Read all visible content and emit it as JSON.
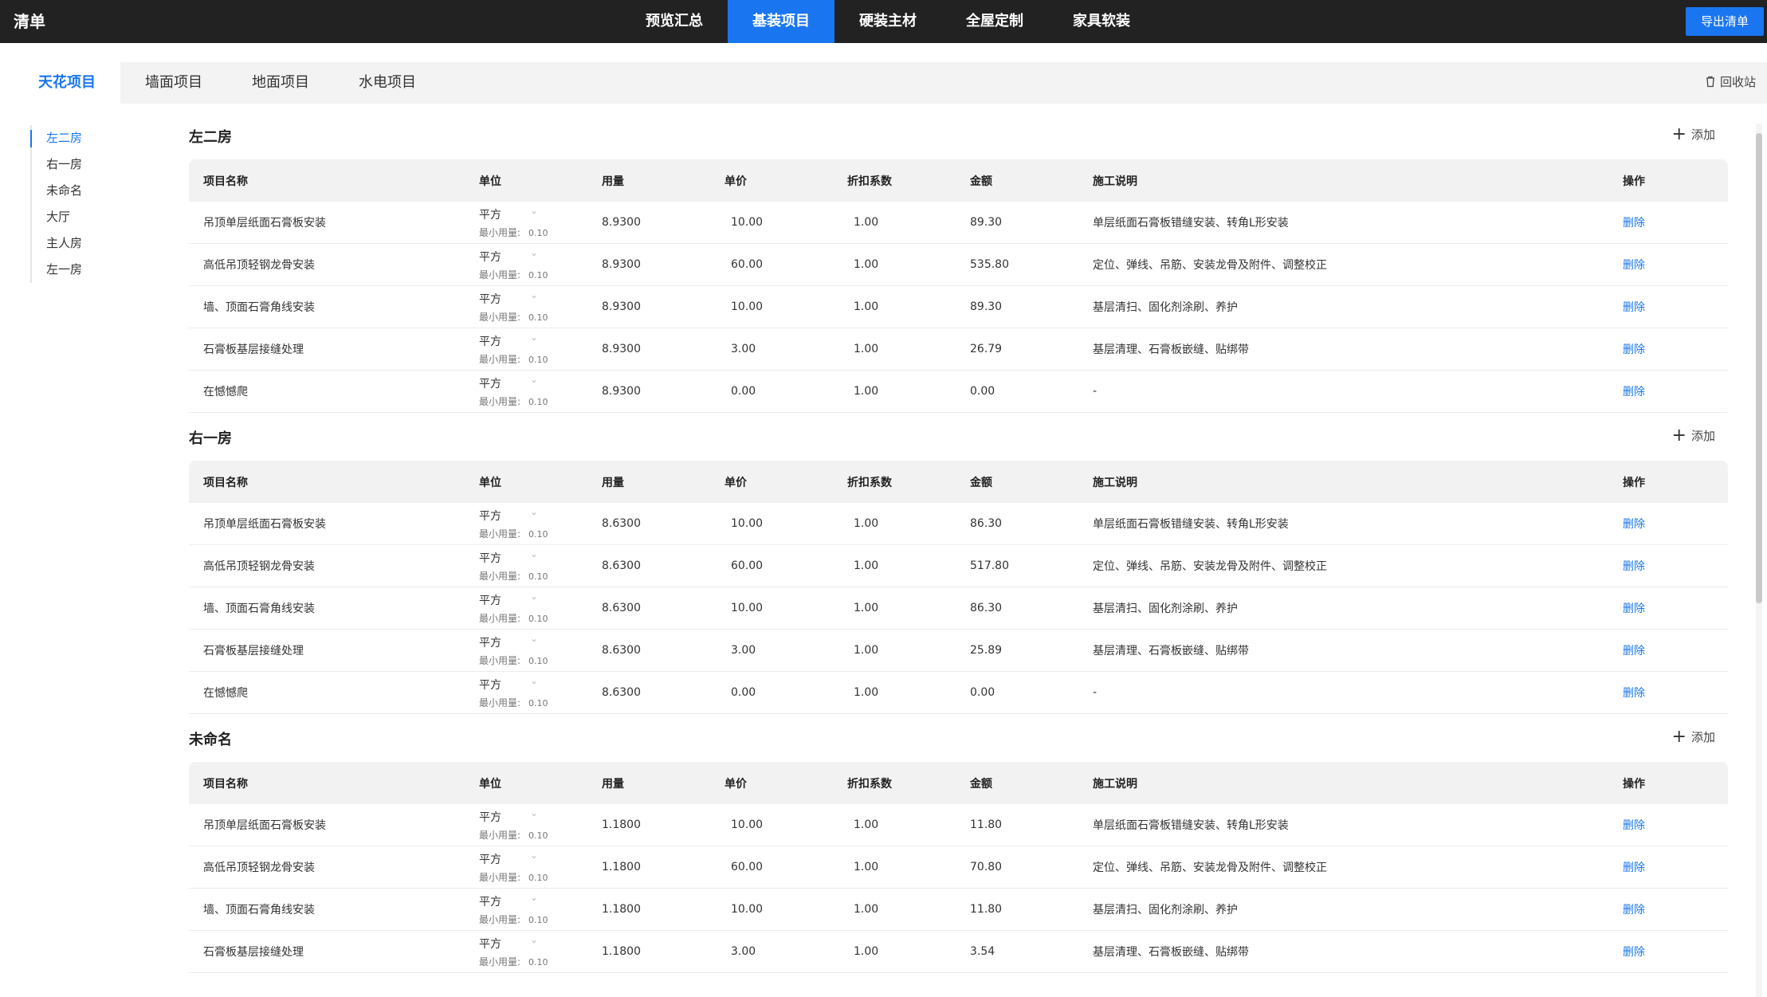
{
  "app": {
    "title": "清单",
    "export_label": "导出清单"
  },
  "topnav": [
    {
      "label": "预览汇总",
      "active": false
    },
    {
      "label": "基装项目",
      "active": true
    },
    {
      "label": "硬装主材",
      "active": false
    },
    {
      "label": "全屋定制",
      "active": false
    },
    {
      "label": "家具软装",
      "active": false
    }
  ],
  "tabs": [
    {
      "label": "天花项目",
      "active": true
    },
    {
      "label": "墙面项目",
      "active": false
    },
    {
      "label": "地面项目",
      "active": false
    },
    {
      "label": "水电项目",
      "active": false
    }
  ],
  "recycle_label": "回收站",
  "rooms": [
    {
      "label": "左二房",
      "active": true
    },
    {
      "label": "右一房",
      "active": false
    },
    {
      "label": "未命名",
      "active": false
    },
    {
      "label": "大厅",
      "active": false
    },
    {
      "label": "主人房",
      "active": false
    },
    {
      "label": "左一房",
      "active": false
    }
  ],
  "columns": {
    "name": "项目名称",
    "unit": "单位",
    "qty": "用量",
    "price": "单价",
    "discount": "折扣系数",
    "amount": "金额",
    "desc": "施工说明",
    "op": "操作"
  },
  "add_label": "添加",
  "delete_label": "删除",
  "min_label": "最小用量:",
  "sections": [
    {
      "title": "左二房",
      "rows": [
        {
          "name": "吊顶单层纸面石膏板安装",
          "unit": "平方",
          "min": "0.10",
          "qty": "8.9300",
          "price": "10.00",
          "discount": "1.00",
          "amount": "89.30",
          "desc": "单层纸面石膏板错缝安装、转角L形安装"
        },
        {
          "name": "高低吊顶轻钢龙骨安装",
          "unit": "平方",
          "min": "0.10",
          "qty": "8.9300",
          "price": "60.00",
          "discount": "1.00",
          "amount": "535.80",
          "desc": "定位、弹线、吊筋、安装龙骨及附件、调整校正"
        },
        {
          "name": "墙、顶面石膏角线安装",
          "unit": "平方",
          "min": "0.10",
          "qty": "8.9300",
          "price": "10.00",
          "discount": "1.00",
          "amount": "89.30",
          "desc": "基层清扫、固化剂涂刷、养护"
        },
        {
          "name": "石膏板基层接缝处理",
          "unit": "平方",
          "min": "0.10",
          "qty": "8.9300",
          "price": "3.00",
          "discount": "1.00",
          "amount": "26.79",
          "desc": "基层清理、石膏板嵌缝、贴绑带"
        },
        {
          "name": "在憾憾爬",
          "unit": "平方",
          "min": "0.10",
          "qty": "8.9300",
          "price": "0.00",
          "discount": "1.00",
          "amount": "0.00",
          "desc": "-"
        }
      ]
    },
    {
      "title": "右一房",
      "rows": [
        {
          "name": "吊顶单层纸面石膏板安装",
          "unit": "平方",
          "min": "0.10",
          "qty": "8.6300",
          "price": "10.00",
          "discount": "1.00",
          "amount": "86.30",
          "desc": "单层纸面石膏板错缝安装、转角L形安装"
        },
        {
          "name": "高低吊顶轻钢龙骨安装",
          "unit": "平方",
          "min": "0.10",
          "qty": "8.6300",
          "price": "60.00",
          "discount": "1.00",
          "amount": "517.80",
          "desc": "定位、弹线、吊筋、安装龙骨及附件、调整校正"
        },
        {
          "name": "墙、顶面石膏角线安装",
          "unit": "平方",
          "min": "0.10",
          "qty": "8.6300",
          "price": "10.00",
          "discount": "1.00",
          "amount": "86.30",
          "desc": "基层清扫、固化剂涂刷、养护"
        },
        {
          "name": "石膏板基层接缝处理",
          "unit": "平方",
          "min": "0.10",
          "qty": "8.6300",
          "price": "3.00",
          "discount": "1.00",
          "amount": "25.89",
          "desc": "基层清理、石膏板嵌缝、贴绑带"
        },
        {
          "name": "在憾憾爬",
          "unit": "平方",
          "min": "0.10",
          "qty": "8.6300",
          "price": "0.00",
          "discount": "1.00",
          "amount": "0.00",
          "desc": "-"
        }
      ]
    },
    {
      "title": "未命名",
      "rows": [
        {
          "name": "吊顶单层纸面石膏板安装",
          "unit": "平方",
          "min": "0.10",
          "qty": "1.1800",
          "price": "10.00",
          "discount": "1.00",
          "amount": "11.80",
          "desc": "单层纸面石膏板错缝安装、转角L形安装"
        },
        {
          "name": "高低吊顶轻钢龙骨安装",
          "unit": "平方",
          "min": "0.10",
          "qty": "1.1800",
          "price": "60.00",
          "discount": "1.00",
          "amount": "70.80",
          "desc": "定位、弹线、吊筋、安装龙骨及附件、调整校正"
        },
        {
          "name": "墙、顶面石膏角线安装",
          "unit": "平方",
          "min": "0.10",
          "qty": "1.1800",
          "price": "10.00",
          "discount": "1.00",
          "amount": "11.80",
          "desc": "基层清扫、固化剂涂刷、养护"
        },
        {
          "name": "石膏板基层接缝处理",
          "unit": "平方",
          "min": "0.10",
          "qty": "1.1800",
          "price": "3.00",
          "discount": "1.00",
          "amount": "3.54",
          "desc": "基层清理、石膏板嵌缝、贴绑带"
        }
      ]
    }
  ]
}
